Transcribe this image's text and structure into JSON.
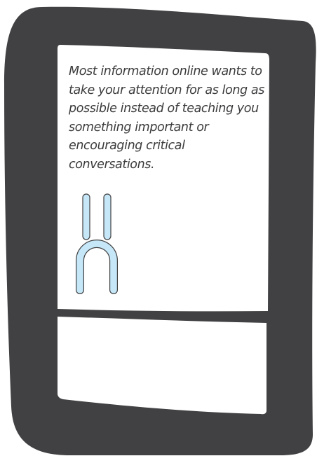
{
  "screen": {
    "message": "Most information online wants to take your attention for as long as possible instead of teaching you something important or encouraging critical conversations."
  },
  "colors": {
    "frame": "#414042",
    "screen": "#ffffff",
    "face_fill": "#c5e7f7",
    "face_stroke": "#414042",
    "text": "#3b3b3d"
  },
  "icons": {
    "face": "sad-face-icon"
  }
}
